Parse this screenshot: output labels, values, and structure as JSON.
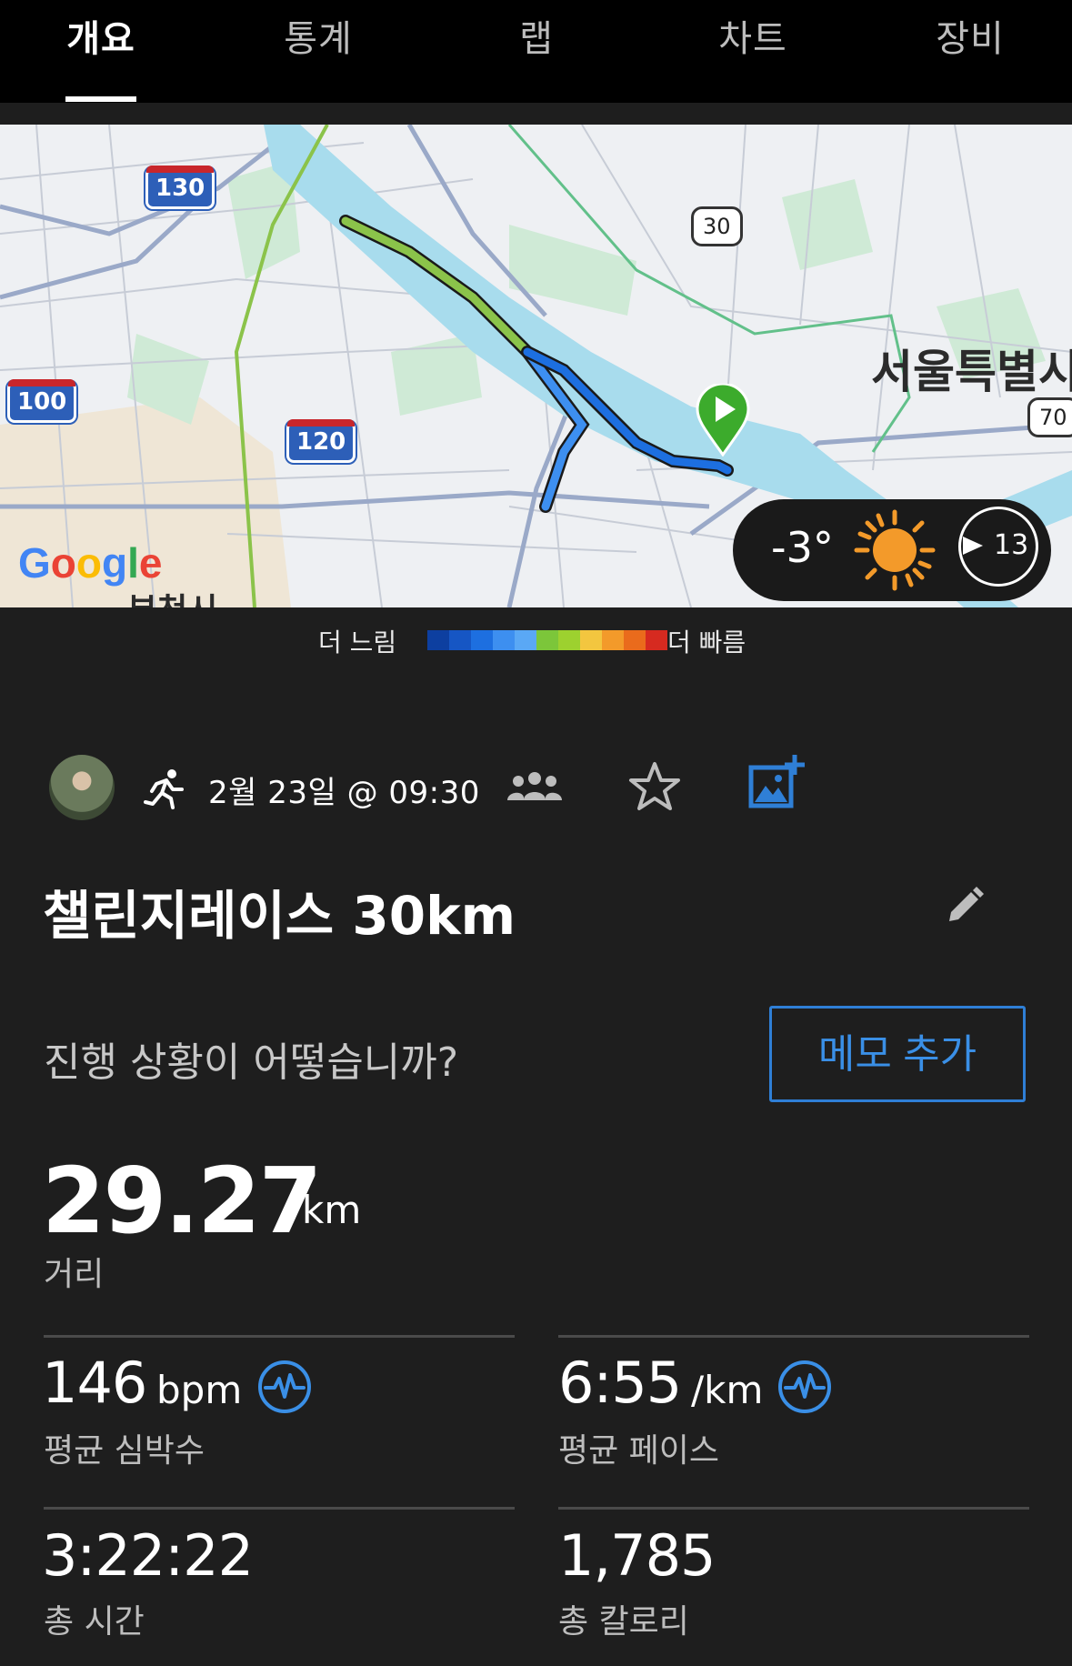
{
  "tabs": [
    {
      "label": "개요",
      "active": true
    },
    {
      "label": "통계",
      "active": false
    },
    {
      "label": "랩",
      "active": false
    },
    {
      "label": "차트",
      "active": false
    },
    {
      "label": "장비",
      "active": false
    }
  ],
  "map": {
    "highway_shields": [
      "130",
      "100",
      "120"
    ],
    "route_shields": [
      "30",
      "70"
    ],
    "city_labels": [
      "서울특별시",
      "부천시"
    ],
    "provider_logo": "Google",
    "weather": {
      "temperature": "-3°",
      "wind_speed": "13",
      "icon": "sun-icon"
    }
  },
  "legend": {
    "slow_label": "더 느림",
    "fast_label": "더 빠름",
    "colors": [
      "#0d3fa0",
      "#1656c4",
      "#1d6fe0",
      "#3d8ff0",
      "#5aa8f5",
      "#7cc63a",
      "#9dd12f",
      "#f3c63f",
      "#f39a2a",
      "#ea6b1c",
      "#d62a20"
    ]
  },
  "activity": {
    "activity_type_icon": "running-icon",
    "date_time": "2월 23일 @ 09:30",
    "title": "챌린지레이스 30km",
    "notes_prompt": "진행 상황이 어떻습니까?",
    "memo_button": "메모 추가"
  },
  "stats": {
    "distance": {
      "value": "29.27",
      "unit": "km",
      "label": "거리"
    },
    "avg_heart_rate": {
      "value": "146",
      "unit": "bpm",
      "label": "평균 심박수"
    },
    "avg_pace": {
      "value": "6:55",
      "unit": "/km",
      "label": "평균 페이스"
    },
    "total_time": {
      "value": "3:22:22",
      "label": "총 시간"
    },
    "total_calories": {
      "value": "1,785",
      "label": "총 칼로리"
    }
  },
  "colors": {
    "accent_blue": "#2f7fd6",
    "background": "#1e1e1e",
    "tab_bar": "#000000"
  }
}
